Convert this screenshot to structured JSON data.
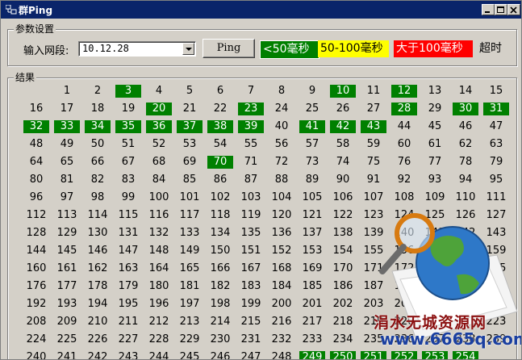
{
  "window": {
    "title": "群Ping"
  },
  "params": {
    "group_label": "参数设置",
    "segment_label": "输入网段:",
    "segment_value": "10.12.28",
    "ping_button": "Ping"
  },
  "legend": {
    "fast": "<50毫秒",
    "medium": "50-100毫秒",
    "slow": "大于100毫秒",
    "timeout": "超时",
    "colors": {
      "fast": "#008000",
      "medium": "#ffff00",
      "slow": "#ff0000",
      "timeout": "#d4d0c8"
    }
  },
  "results": {
    "group_label": "结果",
    "first_host": 1,
    "last_host": 254,
    "responding_hosts": [
      3,
      10,
      12,
      20,
      23,
      28,
      30,
      31,
      32,
      33,
      34,
      35,
      36,
      37,
      38,
      39,
      41,
      42,
      43,
      70,
      249,
      250,
      251,
      252,
      253,
      254
    ]
  },
  "watermark": {
    "text": "涓水无城资源网",
    "url": "www.6665q.com"
  }
}
